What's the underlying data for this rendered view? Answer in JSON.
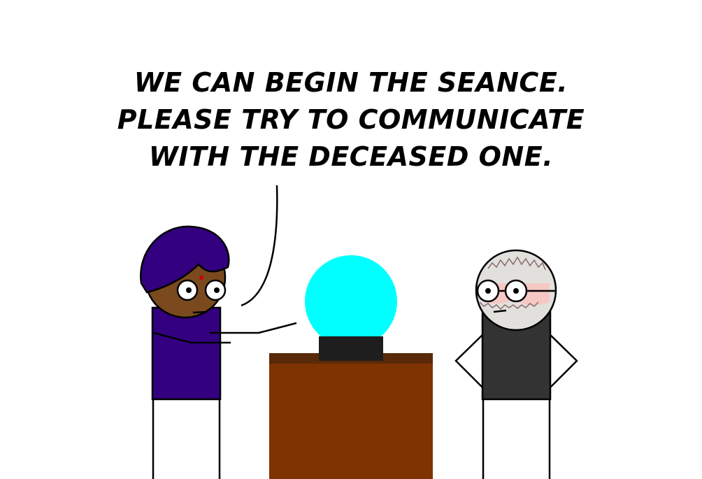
{
  "speech": {
    "lines": [
      "WE CAN BEGIN THE SEANCE.",
      "PLEASE TRY TO COMMUNICATE",
      "WITH THE DECEASED ONE."
    ]
  },
  "colors": {
    "background": "#ffffff",
    "turban": "#330080",
    "robe": "#330080",
    "psychic_skin": "#7a4a1e",
    "bindi": "#cc0000",
    "crystal_ball": "#00ffff",
    "ball_stand": "#1e1e1e",
    "table_top": "#5a2a08",
    "table": "#7f3300",
    "client_head": "#e2e0dd",
    "client_blush": "#f5c8c4",
    "client_shirt": "#333333",
    "outline": "#000000"
  },
  "icons": {
    "psychic": "psychic-figure",
    "crystal_ball": "crystal-ball-icon",
    "table": "table",
    "client": "client-figure"
  }
}
